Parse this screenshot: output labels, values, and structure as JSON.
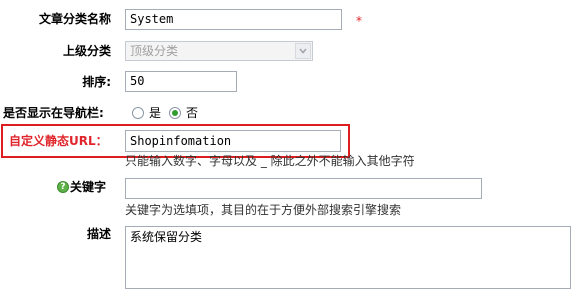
{
  "form": {
    "name": {
      "label": "文章分类名称",
      "value": "System",
      "required_mark": "*"
    },
    "parent": {
      "label": "上级分类",
      "selected": "顶级分类"
    },
    "sort": {
      "label": "排序:",
      "value": "50"
    },
    "show_in_nav": {
      "label": "是否显示在导航栏:",
      "options": [
        {
          "label": "是",
          "checked": false
        },
        {
          "label": "否",
          "checked": true
        }
      ]
    },
    "custom_url": {
      "label": "自定义静态URL：",
      "value": "Shopinfomation",
      "hint": "只能输入数字、字母以及 _ 除此之外不能输入其他字符"
    },
    "keywords": {
      "label": "关键字",
      "value": "",
      "hint": "关键字为选填项，其目的在于方便外部搜索引擎搜索"
    },
    "description": {
      "label": "描述",
      "value": "系统保留分类"
    }
  },
  "colors": {
    "required": "#e0262c",
    "highlight": "#dc1e1e",
    "radio_checked": "#2e9c2e"
  },
  "icons": {
    "keywords_help": "help-icon"
  }
}
